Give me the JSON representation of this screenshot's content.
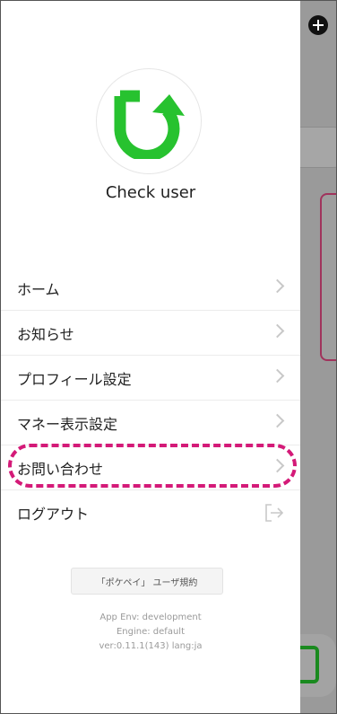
{
  "user": {
    "name": "Check user"
  },
  "menu": [
    {
      "label": "ホーム",
      "icon": "chevron-right-icon"
    },
    {
      "label": "お知らせ",
      "icon": "chevron-right-icon"
    },
    {
      "label": "プロフィール設定",
      "icon": "chevron-right-icon"
    },
    {
      "label": "マネー表示設定",
      "icon": "chevron-right-icon"
    },
    {
      "label": "お問い合わせ",
      "icon": "chevron-right-icon"
    },
    {
      "label": "ログアウト",
      "icon": "logout-icon"
    }
  ],
  "terms_button": "「ポケペイ」 ユーザ規約",
  "app_info": {
    "env": "App Env: development",
    "engine": "Engine: default",
    "version": "ver:0.11.1(143) lang:ja"
  },
  "colors": {
    "logo_green": "#27c22f",
    "highlight": "#d41a78"
  }
}
